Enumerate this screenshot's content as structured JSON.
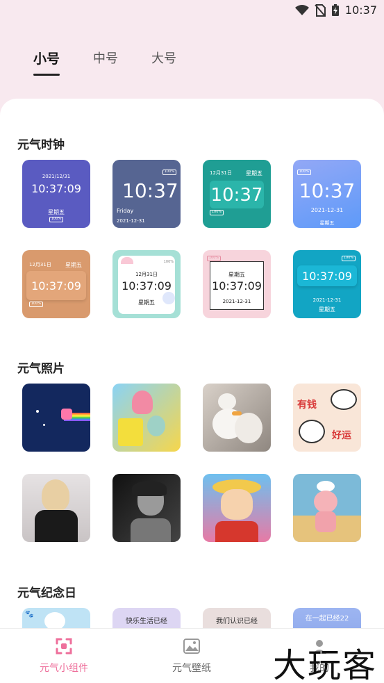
{
  "status_bar": {
    "time": "10:37"
  },
  "tabs": [
    {
      "label": "小号",
      "active": true
    },
    {
      "label": "中号",
      "active": false
    },
    {
      "label": "大号",
      "active": false
    }
  ],
  "sections": {
    "clock": {
      "title": "元气时钟"
    },
    "photo": {
      "title": "元气照片"
    },
    "anniversary": {
      "title": "元气纪念日"
    }
  },
  "clock_tiles": [
    {
      "date": "2021/12/31",
      "time": "10:37:09",
      "week": "星期五",
      "battery": "100%",
      "bg": "#5a5bc1"
    },
    {
      "time": "10:37",
      "day": "Friday",
      "date": "2021-12-31",
      "battery": "100%",
      "bg": "#566592"
    },
    {
      "date": "12月31日",
      "week": "星期五",
      "time": "10:37",
      "battery": "100%",
      "bg": "#1f9e94"
    },
    {
      "time": "10:37",
      "date": "2021-12-31",
      "week": "星期五",
      "battery": "100%",
      "bg": "#6b93f7"
    },
    {
      "date": "12月31日",
      "week": "星期五",
      "time": "10:37:09",
      "battery": "100%",
      "bg": "#d99a6d"
    },
    {
      "date": "12月31日",
      "time": "10:37:09",
      "week": "星期五",
      "battery": "100%",
      "bg": "#a5e0d6"
    },
    {
      "week": "星期五",
      "time": "10:37:09",
      "date": "2021-12-31",
      "battery": "100%",
      "bg": "#f7d4dc"
    },
    {
      "time": "10:37:09",
      "date": "2021-12-31",
      "week": "星期五",
      "battery": "100%",
      "bg": "#12a5c4"
    }
  ],
  "anniversary_tiles": [
    {
      "text": ""
    },
    {
      "text": "快乐生活已经"
    },
    {
      "text": "我们认识已经"
    },
    {
      "text": "在一起已经22"
    }
  ],
  "bottom_nav": [
    {
      "label": "元气小组件",
      "active": true
    },
    {
      "label": "元气壁纸",
      "active": false
    },
    {
      "label": "我的",
      "active": false
    }
  ],
  "watermark": "大玩客",
  "colors": {
    "accent": "#ee6f9b",
    "header_bg": "#f8e9ef"
  }
}
